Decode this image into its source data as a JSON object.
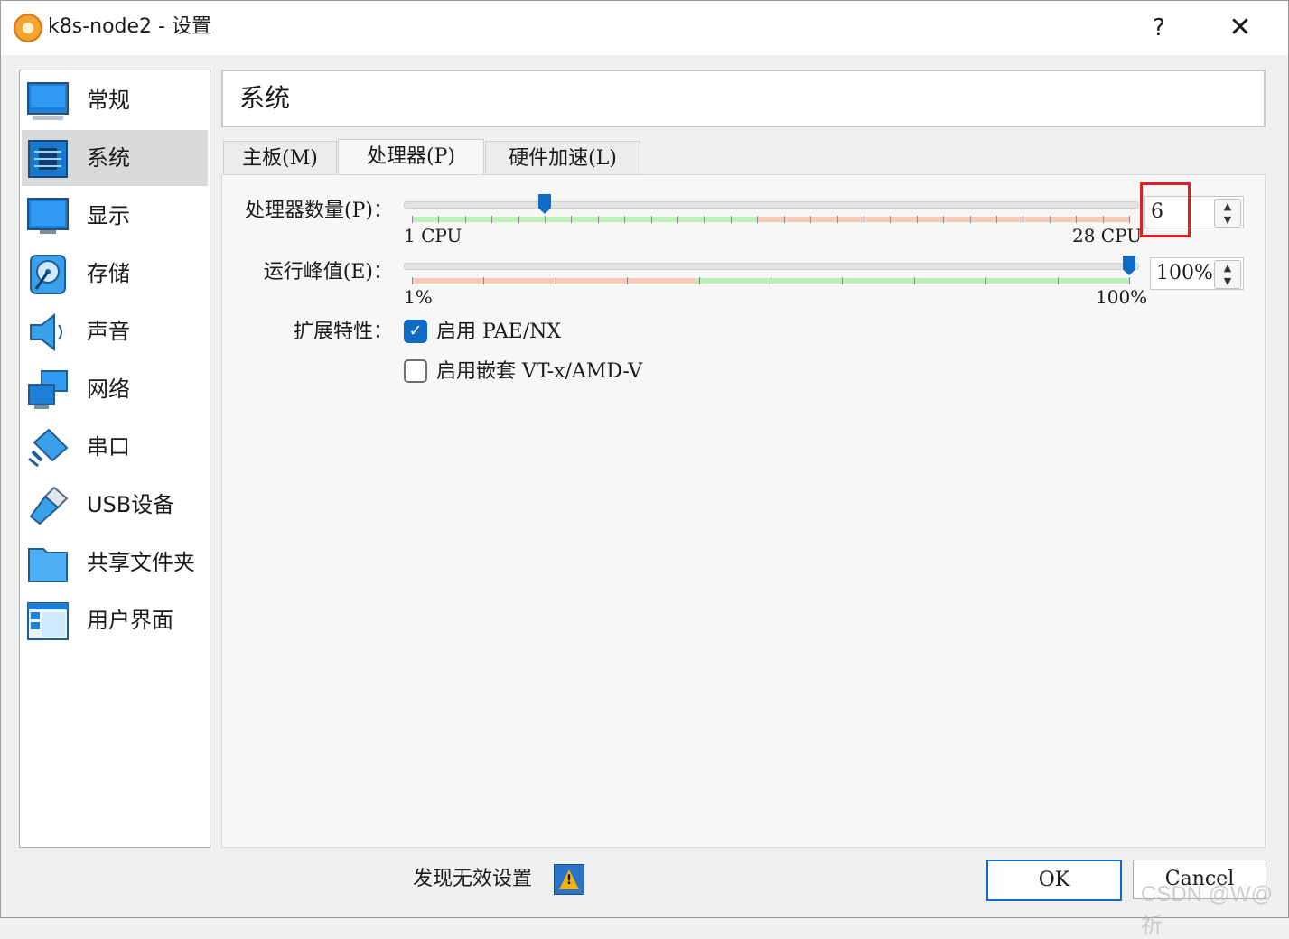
{
  "window": {
    "title": "k8s-node2 - 设置",
    "help_label": "?",
    "close_label": "✕"
  },
  "sidebar": {
    "items": [
      {
        "label": "常规",
        "icon": "monitor-icon"
      },
      {
        "label": "系统",
        "icon": "chip-icon"
      },
      {
        "label": "显示",
        "icon": "display-icon"
      },
      {
        "label": "存储",
        "icon": "disk-icon"
      },
      {
        "label": "声音",
        "icon": "speaker-icon"
      },
      {
        "label": "网络",
        "icon": "network-icon"
      },
      {
        "label": "串口",
        "icon": "serial-port-icon"
      },
      {
        "label": "USB设备",
        "icon": "usb-icon"
      },
      {
        "label": "共享文件夹",
        "icon": "folder-icon"
      },
      {
        "label": "用户界面",
        "icon": "window-ui-icon"
      }
    ],
    "selected": "系统"
  },
  "header": {
    "title": "系统"
  },
  "tabs": [
    {
      "label": "主板(M)"
    },
    {
      "label": "处理器(P)"
    },
    {
      "label": "硬件加速(L)"
    }
  ],
  "active_tab": "处理器(P)",
  "processor": {
    "count_label": "处理器数量(P)：",
    "count_value": "6",
    "count_min_label": "1 CPU",
    "count_max_label": "28 CPU",
    "count_min": 1,
    "count_max": 28,
    "count_recommended_max": 14,
    "cap_label": "运行峰值(E)：",
    "cap_value": "100%",
    "cap_min_label": "1%",
    "cap_max_label": "100%",
    "cap_value_num": 100,
    "cap_warning_below": 40,
    "extended_label": "扩展特性：",
    "pae_label": "启用 PAE/NX",
    "pae_checked": true,
    "vtx_label": "启用嵌套 VT-x/AMD-V",
    "vtx_checked": false
  },
  "footer": {
    "warning_text": "发现无效设置",
    "ok_label": "OK",
    "cancel_label": "Cancel",
    "watermark": "CSDN @W@祈"
  },
  "colors": {
    "accent": "#0f6cc5",
    "safe_zone": "#bdf0b7",
    "warn_zone": "#f7c9b8",
    "highlight": "#e02020"
  }
}
